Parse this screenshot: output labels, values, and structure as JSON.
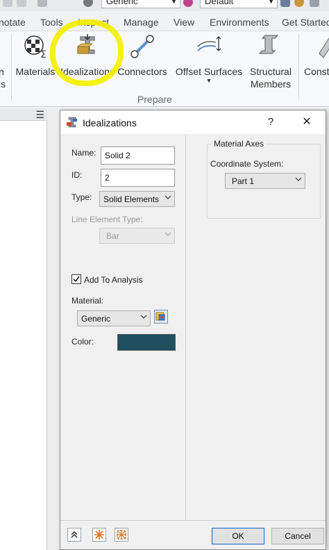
{
  "quick_access": {
    "material_combo": "Generic",
    "appearance_combo": "Default"
  },
  "tabs": [
    "notate",
    "Tools",
    "Inspect",
    "Manage",
    "View",
    "Environments",
    "Get Started"
  ],
  "ribbon": {
    "buttons": {
      "materials": "Materials",
      "idealizations": "Idealizations",
      "connectors": "Connectors",
      "offset_surfaces": "Offset Surfaces",
      "structural_members_1": "Structural",
      "structural_members_2": "Members",
      "construction": "Const"
    },
    "left_cut_1": "n",
    "left_cut_2": "is",
    "panel_label": "Prepare",
    "highlight_color": "#f4f000"
  },
  "dialog": {
    "title": "Idealizations",
    "help": "?",
    "close": "✕",
    "name_label": "Name:",
    "name_value": "Solid 2",
    "id_label": "ID:",
    "id_value": "2",
    "type_label": "Type:",
    "type_value": "Solid Elements",
    "line_element_type_label": "Line Element Type:",
    "line_element_type_value": "Bar",
    "add_to_analysis_label": "Add To Analysis",
    "add_to_analysis_checked": true,
    "material_label": "Material:",
    "material_value": "Generic",
    "color_label": "Color:",
    "color_value": "#1e5060",
    "material_axes_title": "Material Axes",
    "coordinate_system_label": "Coordinate System:",
    "coordinate_system_value": "Part 1",
    "ok": "OK",
    "cancel": "Cancel"
  }
}
